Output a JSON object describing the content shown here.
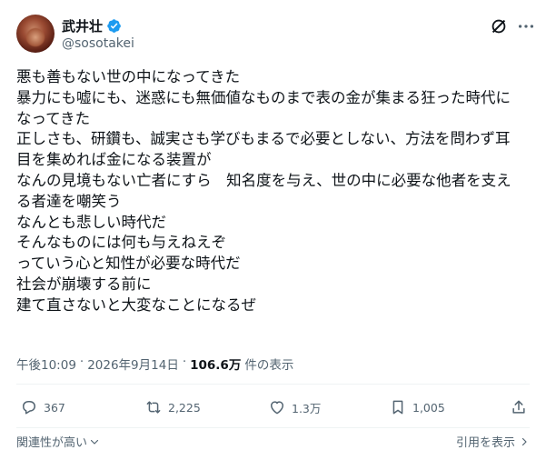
{
  "post": {
    "author": {
      "display_name": "武井壮",
      "handle": "@sosotakei"
    },
    "body_lines": [
      "悪も善もない世の中になってきた",
      "暴力にも嘘にも、迷惑にも無価値なものまで表の金が集まる狂った時代に",
      "なってきた",
      "正しさも、研鑽も、誠実さも学びもまるで必要としない、方法を問わず耳",
      "目を集めれば金になる装置が",
      "なんの見境もない亡者にすら　知名度を与え、世の中に必要な他者を支え",
      "る者達を嘲笑う",
      "なんとも悲しい時代だ",
      "そんなものには何も与えねえぞ",
      "っていう心と知性が必要な時代だ",
      "社会が崩壊する前に",
      "建て直さないと大変なことになるぜ"
    ],
    "meta": {
      "time": "午後10:09",
      "separator": "·",
      "date": "2026年9月14日",
      "views_count": "106.6万",
      "views_label": "件の表示"
    },
    "actions": {
      "reply_count": "367",
      "repost_count": "2,225",
      "like_count": "1.3万",
      "bookmark_count": "1,005"
    },
    "footer": {
      "relevance_label": "関連性が高い",
      "quotes_label": "引用を表示"
    }
  },
  "icons": {
    "verified": "verified-badge-icon",
    "grok": "grok-icon",
    "more": "more-icon",
    "reply": "reply-icon",
    "repost": "repost-icon",
    "like": "like-icon",
    "bookmark": "bookmark-icon",
    "share": "share-icon"
  },
  "colors": {
    "verified": "#1d9bf0",
    "text_primary": "#0f1419",
    "text_secondary": "#536471"
  }
}
